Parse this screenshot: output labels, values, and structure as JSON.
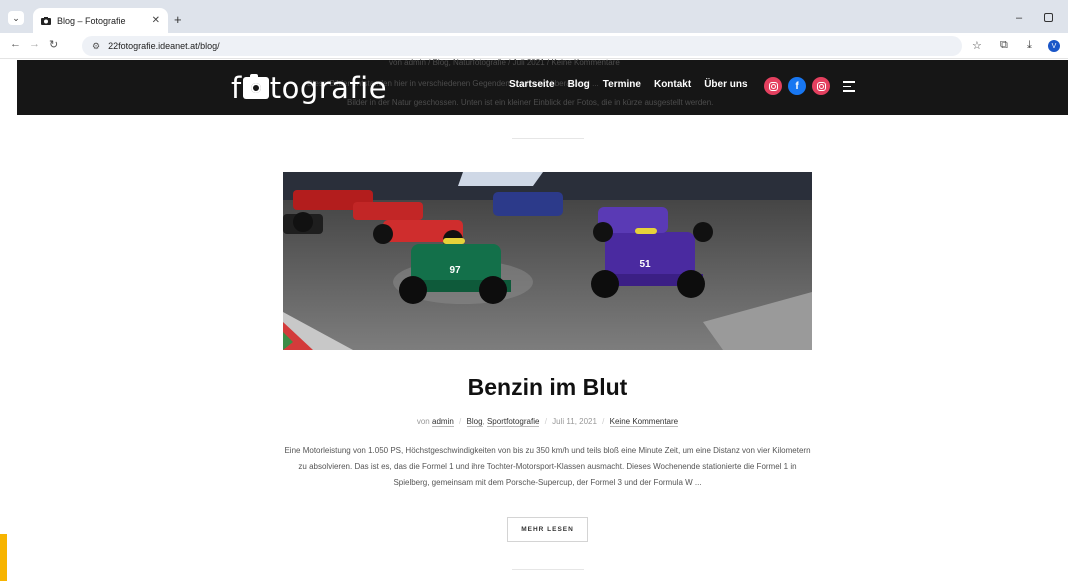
{
  "browser": {
    "tab_title": "Blog – Fotografie",
    "url": "22fotografie.ideanet.at/blog/",
    "profile_initial": "V"
  },
  "header": {
    "logo_prefix": "f",
    "logo_suffix": "tografie",
    "nav": [
      "Startseite",
      "Blog",
      "Termine",
      "Kontakt",
      "Über uns"
    ],
    "social_icons": [
      "instagram-icon",
      "facebook-icon",
      "instagram-icon"
    ],
    "ghost_meta": "von admin  /  Blog, Naturfotografie  /  Juli 2021  /  Keine Kommentare",
    "ghost_text_1": "Diese Bilder entstanden hier in verschiedenen Gegenden ... wir sind überall und ...",
    "ghost_text_2": "Bilder in der Natur geschossen. Unten ist ein kleiner Einblick der Fotos, die in kürze ausgestellt werden."
  },
  "post": {
    "title": "Benzin im Blut",
    "meta_prefix": "von",
    "author": "admin",
    "cat1": "Blog",
    "cat2": "Sportfotografie",
    "date": "Juli 11, 2021",
    "comments": "Keine Kommentare",
    "excerpt": "Eine Motorleistung von 1.050 PS, Höchstgeschwindigkeiten von bis zu 350 km/h und teils bloß eine Minute Zeit, um eine Distanz von vier Kilometern zu absolvieren. Das ist es, das die Formel 1 und ihre Tochter-Motorsport-Klassen ausmacht. Dieses Wochenende stationierte die Formel 1 in Spielberg, gemeinsam mit dem Porsche-Supercup, der Formel 3 und der Formula W ...",
    "read_more": "MEHR LESEN",
    "car_numbers": [
      "97",
      "51"
    ]
  },
  "colors": {
    "header_bg": "#161616",
    "instagram": "#e4405f",
    "facebook": "#1877f2",
    "accent": "#f7b400"
  }
}
